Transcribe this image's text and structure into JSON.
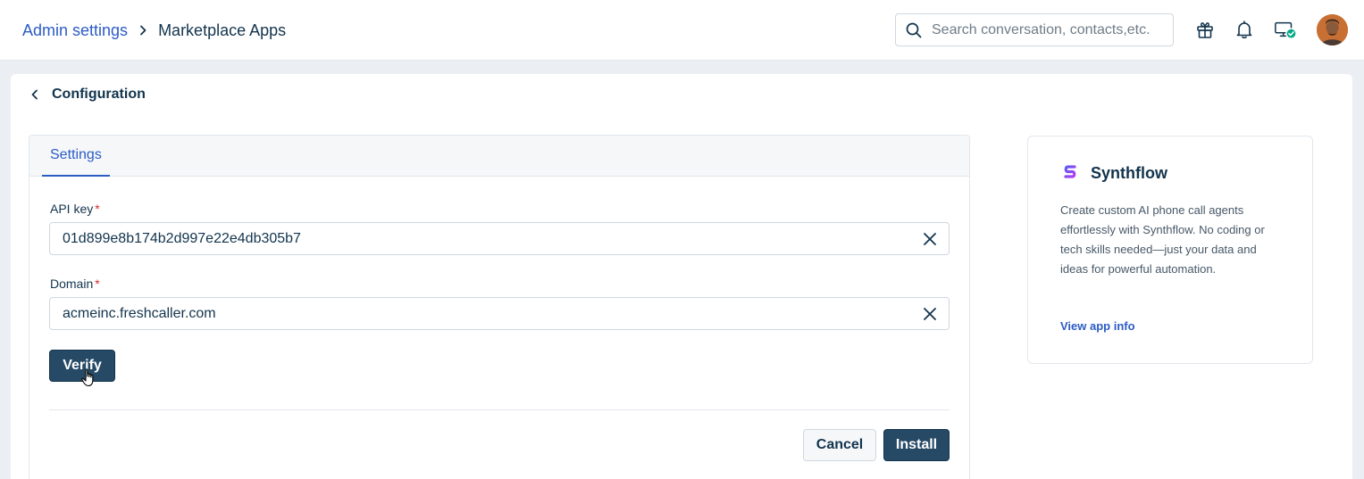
{
  "header": {
    "breadcrumb_parent": "Admin settings",
    "breadcrumb_current": "Marketplace Apps",
    "search_placeholder": "Search conversation, contacts,etc.",
    "icons": [
      "gift-icon",
      "bell-icon",
      "monitor-status-icon",
      "avatar"
    ]
  },
  "page": {
    "title": "Configuration"
  },
  "settings": {
    "tab_label": "Settings",
    "api_key_label": "API key",
    "api_key_value": "01d899e8b174b2d997e22e4db305b7",
    "domain_label": "Domain",
    "domain_value": "acmeinc.freshcaller.com",
    "required_marker": "*",
    "verify_label": "Verify",
    "cancel_label": "Cancel",
    "install_label": "Install"
  },
  "app_info": {
    "name": "Synthflow",
    "description": "Create custom AI phone call agents effortlessly with Synthflow. No coding or tech skills needed—just your data and ideas for powerful automation.",
    "link_label": "View app info"
  },
  "colors": {
    "accent": "#2c5cc5",
    "primary_button": "#264966",
    "text": "#12344d",
    "required": "#d72d30",
    "status_ok": "#00a886"
  }
}
